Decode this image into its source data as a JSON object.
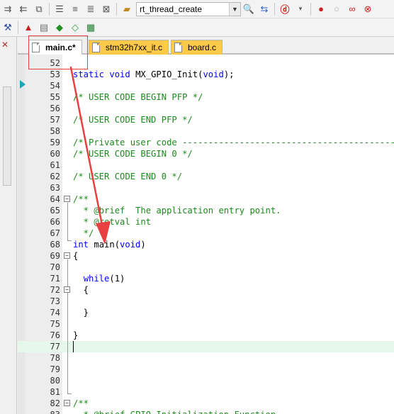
{
  "toolbar": {
    "target_name": "rt_thread_create"
  },
  "tabs": [
    {
      "label": "main.c*",
      "active": true
    },
    {
      "label": "stm32h7xx_it.c",
      "active": false
    },
    {
      "label": "board.c",
      "active": false
    }
  ],
  "editor": {
    "current_line": 77,
    "lines": [
      {
        "num": "52",
        "html": ""
      },
      {
        "num": "53",
        "html": "<span class=\"kw\">static</span> <span class=\"kw\">void</span> MX_GPIO_Init(<span class=\"kw\">void</span>);"
      },
      {
        "num": "54",
        "html": ""
      },
      {
        "num": "55",
        "html": "<span class=\"cm\">/* USER CODE BEGIN PFP */</span>"
      },
      {
        "num": "56",
        "html": ""
      },
      {
        "num": "57",
        "html": "<span class=\"cm\">/* USER CODE END PFP */</span>"
      },
      {
        "num": "58",
        "html": ""
      },
      {
        "num": "59",
        "html": "<span class=\"cm\">/* Private user code ---------------------------------------------------------</span>"
      },
      {
        "num": "60",
        "html": "<span class=\"cm\">/* USER CODE BEGIN 0 */</span>"
      },
      {
        "num": "61",
        "html": ""
      },
      {
        "num": "62",
        "html": "<span class=\"cm\">/* USER CODE END 0 */</span>"
      },
      {
        "num": "63",
        "html": ""
      },
      {
        "num": "64",
        "html": "<span class=\"cm\">/**</span>"
      },
      {
        "num": "65",
        "html": "<span class=\"cm\">  * @brief  The application entry point.</span>"
      },
      {
        "num": "66",
        "html": "<span class=\"cm\">  * @retval int</span>"
      },
      {
        "num": "67",
        "html": "<span class=\"cm\">  */</span>"
      },
      {
        "num": "68",
        "html": "<span class=\"kw\">int</span> main(<span class=\"kw\">void</span>)"
      },
      {
        "num": "69",
        "html": "{"
      },
      {
        "num": "70",
        "html": ""
      },
      {
        "num": "71",
        "html": "  <span class=\"kw\">while</span>(1)"
      },
      {
        "num": "72",
        "html": "  {"
      },
      {
        "num": "73",
        "html": ""
      },
      {
        "num": "74",
        "html": "  }"
      },
      {
        "num": "75",
        "html": ""
      },
      {
        "num": "76",
        "html": "}"
      },
      {
        "num": "77",
        "html": ""
      },
      {
        "num": "78",
        "html": ""
      },
      {
        "num": "79",
        "html": ""
      },
      {
        "num": "80",
        "html": ""
      },
      {
        "num": "81",
        "html": ""
      },
      {
        "num": "82",
        "html": "<span class=\"cm\">/**</span>"
      },
      {
        "num": "83",
        "html": "<span class=\"cm\">  * @brief GPIO Initialization Function</span>"
      }
    ]
  },
  "colors": {
    "keyword": "#0000ff",
    "comment": "#1c8a1c",
    "current_line": "#e6f8ea",
    "annotation": "#e84040",
    "modified_tab": "#ffc94a"
  }
}
